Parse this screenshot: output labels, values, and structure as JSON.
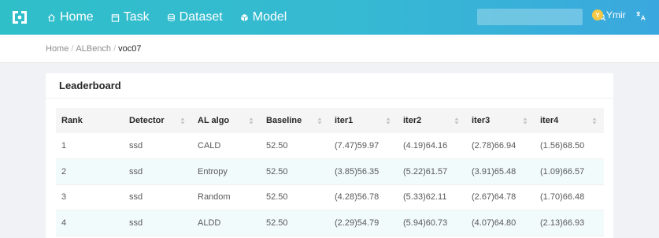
{
  "nav": {
    "items": [
      {
        "icon": "home-icon",
        "label": "Home"
      },
      {
        "icon": "task-icon",
        "label": "Task"
      },
      {
        "icon": "dataset-icon",
        "label": "Dataset"
      },
      {
        "icon": "model-icon",
        "label": "Model"
      }
    ]
  },
  "search": {
    "placeholder": ""
  },
  "user": {
    "initial": "Y",
    "name": "Ymir"
  },
  "breadcrumb": {
    "items": [
      "Home",
      "ALBench",
      "voc07"
    ],
    "separator": "/"
  },
  "leaderboard": {
    "title": "Leaderboard",
    "columns": [
      "Rank",
      "Detector",
      "AL algo",
      "Baseline",
      "iter1",
      "iter2",
      "iter3",
      "iter4"
    ],
    "rows": [
      [
        "1",
        "ssd",
        "CALD",
        "52.50",
        "(7.47)59.97",
        "(4.19)64.16",
        "(2.78)66.94",
        "(1.56)68.50"
      ],
      [
        "2",
        "ssd",
        "Entropy",
        "52.50",
        "(3.85)56.35",
        "(5.22)61.57",
        "(3.91)65.48",
        "(1.09)66.57"
      ],
      [
        "3",
        "ssd",
        "Random",
        "52.50",
        "(4.28)56.78",
        "(5.33)62.11",
        "(2.67)64.78",
        "(1.70)66.48"
      ],
      [
        "4",
        "ssd",
        "ALDD",
        "52.50",
        "(2.29)54.79",
        "(5.94)60.73",
        "(4.07)64.80",
        "(2.13)66.93"
      ]
    ]
  },
  "colors": {
    "header_gradient_start": "#2fbfc9",
    "header_gradient_end": "#3aa8de",
    "row_stripe": "#f2fbfb",
    "avatar": "#f6c845"
  }
}
